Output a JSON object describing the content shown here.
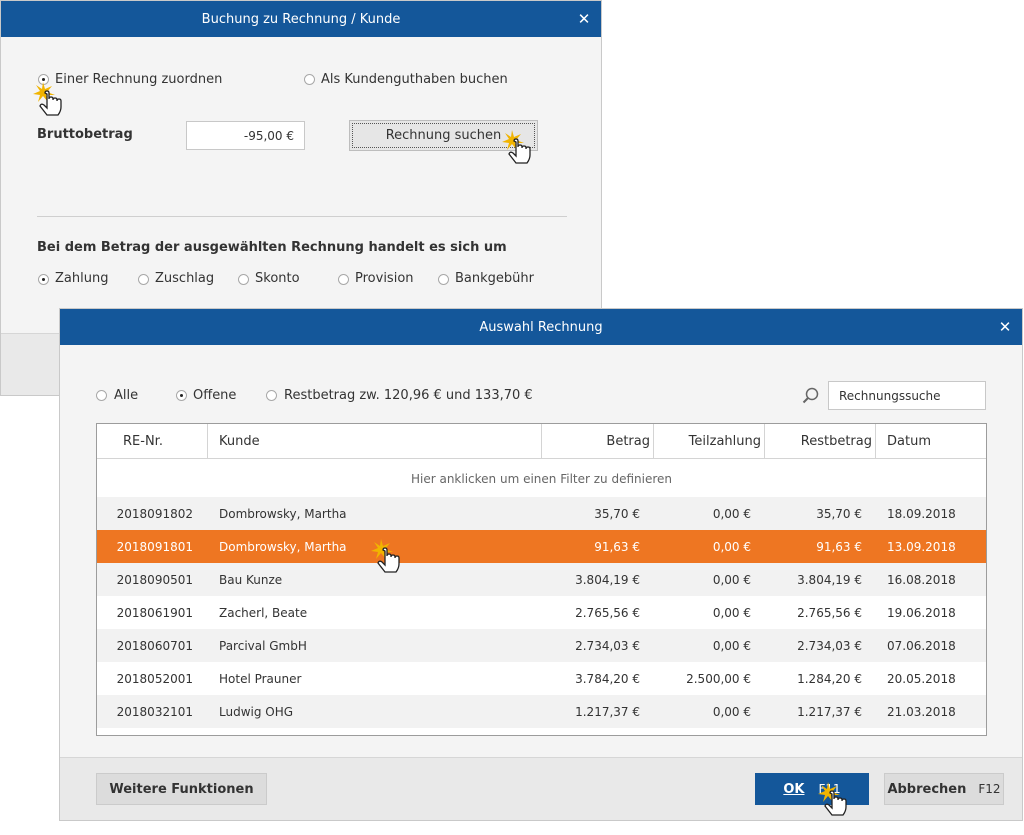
{
  "back_dialog": {
    "title": "Buchung zu Rechnung / Kunde",
    "radio_invoice": "Einer Rechnung zuordnen",
    "radio_credit": "Als Kundenguthaben buchen",
    "gross_label": "Bruttobetrag",
    "gross_value": "-95,00 €",
    "search_invoice_button": "Rechnung suchen",
    "type_question": "Bei dem Betrag der ausgewählten Rechnung handelt es sich um",
    "types": [
      "Zahlung",
      "Zuschlag",
      "Skonto",
      "Provision",
      "Bankgebühr"
    ]
  },
  "front_dialog": {
    "title": "Auswahl Rechnung",
    "filters": [
      "Alle",
      "Offene",
      "Restbetrag zw. 120,96 € und 133,70 €"
    ],
    "search_value": "Rechnungssuche",
    "columns": [
      "RE-Nr.",
      "Kunde",
      "Betrag",
      "Teilzahlung",
      "Restbetrag",
      "Datum"
    ],
    "filter_hint": "Hier anklicken um einen Filter zu definieren",
    "rows": [
      [
        "2018091802",
        "Dombrowsky, Martha",
        "35,70 €",
        "0,00 €",
        "35,70 €",
        "18.09.2018"
      ],
      [
        "2018091801",
        "Dombrowsky, Martha",
        "91,63 €",
        "0,00 €",
        "91,63 €",
        "13.09.2018"
      ],
      [
        "2018090501",
        "Bau Kunze",
        "3.804,19 €",
        "0,00 €",
        "3.804,19 €",
        "16.08.2018"
      ],
      [
        "2018061901",
        "Zacherl, Beate",
        "2.765,56 €",
        "0,00 €",
        "2.765,56 €",
        "19.06.2018"
      ],
      [
        "2018060701",
        "Parcival GmbH",
        "2.734,03 €",
        "0,00 €",
        "2.734,03 €",
        "07.06.2018"
      ],
      [
        "2018052001",
        "Hotel Prauner",
        "3.784,20 €",
        "2.500,00 €",
        "1.284,20 €",
        "20.05.2018"
      ],
      [
        "2018032101",
        "Ludwig OHG",
        "1.217,37 €",
        "0,00 €",
        "1.217,37 €",
        "21.03.2018"
      ]
    ],
    "more_functions_button": "Weitere Funktionen",
    "ok_button": "OK",
    "ok_shortcut": "F11",
    "cancel_button": "Abbrechen",
    "cancel_shortcut": "F12"
  },
  "icons": {
    "close": "close-icon",
    "search": "magnifier-icon",
    "pointer": "hand-pointer-icon"
  },
  "colors": {
    "titlebar": "#14579a",
    "selection": "#ee7622",
    "ok_button": "#14579a"
  }
}
